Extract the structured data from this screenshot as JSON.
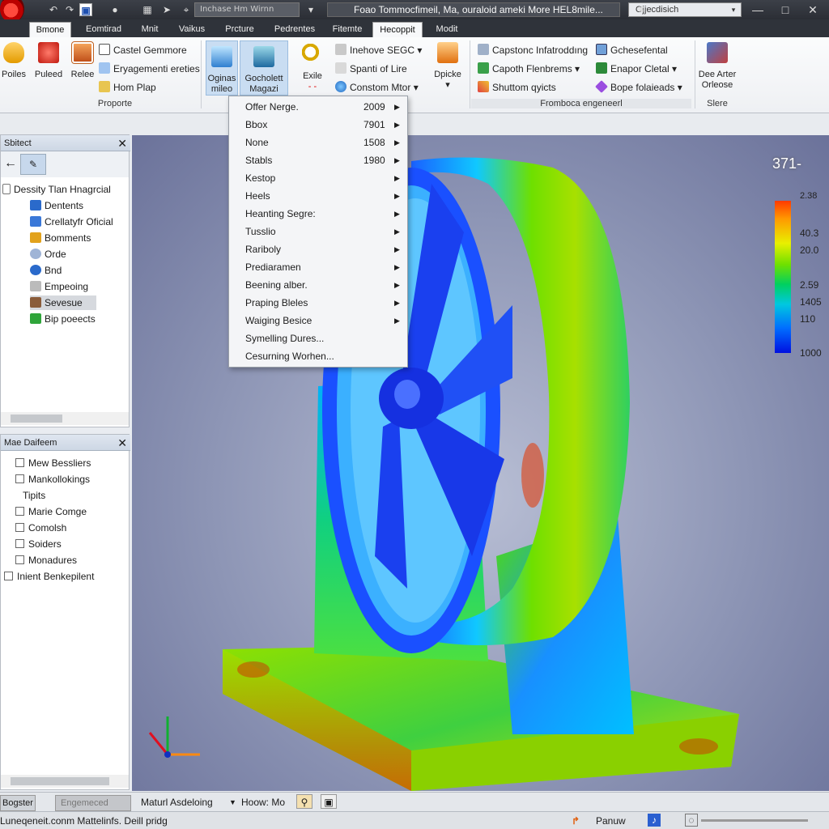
{
  "window": {
    "title": "Foao Tommocfimeil, Ma, ouraloid ameki More HEL8mile...",
    "document_tab": "Inchase Hm Wirnn",
    "search_placeholder": "Ojjecdisich"
  },
  "tabs": [
    "Bmone",
    "Eomtirad",
    "Mnit",
    "Vaikus",
    "Prcture",
    "Pedrentes",
    "Fitemte",
    "Hecoppit",
    "Modit"
  ],
  "ribbon": {
    "poiles": "Poiles",
    "pulled": "Puleed",
    "relee": "Relee",
    "small1": [
      "Castel Gemmore",
      "Eryagementi ereties",
      "Hom Plap"
    ],
    "group1": "Proporte",
    "oginas": [
      "Oginas",
      "mileo"
    ],
    "gocholett": [
      "Gocholett",
      "Magazi"
    ],
    "exile": "Exile",
    "small2": [
      "Inehove SEGC",
      "Spanti of Lire",
      "Constom Mtor"
    ],
    "dpicke": "Dpicke",
    "small3": [
      "Capstonc Infatroddıng",
      "Capoth Flenbrems",
      "Shuttom qyicts"
    ],
    "small4": [
      "Gchesefental",
      "Enapor Cletal",
      "Bope folaieads"
    ],
    "group2": "Fromboca engeneerl",
    "dee": [
      "Dee Arter",
      "Orleose"
    ],
    "group3": "Slere"
  },
  "menu": [
    {
      "label": "Offer Nerge.",
      "num": "2009"
    },
    {
      "label": "Bbox",
      "num": "7901"
    },
    {
      "label": "None",
      "num": "1508"
    },
    {
      "label": "Stabls",
      "num": "1980"
    },
    {
      "label": "Kestop",
      "num": ""
    },
    {
      "label": "Heels",
      "num": ""
    },
    {
      "label": "Heanting Segre:",
      "num": ""
    },
    {
      "label": "Tusslio",
      "num": ""
    },
    {
      "label": "Rariboly",
      "num": ""
    },
    {
      "label": "Prediaramen",
      "num": ""
    },
    {
      "label": "Beening alber.",
      "num": ""
    },
    {
      "label": "Praping Bleles",
      "num": ""
    },
    {
      "label": "Waiging Besice",
      "num": ""
    },
    {
      "label": "Symelling Dures...",
      "num": ""
    },
    {
      "label": "Cesurning Worhen...",
      "num": ""
    }
  ],
  "object_panel": {
    "title": "Sbitect",
    "items": [
      "Dessity Tlan Hnagrcial",
      "Dentents",
      "Crellatyfr Oficial",
      "Bomments",
      "Orde",
      "Bnd",
      "Empeoing",
      "Sevesue",
      "Bip poeects"
    ]
  },
  "feature_panel": {
    "title": "Mae Daifeem",
    "items": [
      "Mew Bessliers",
      "Mankollokings",
      "Tipits",
      "Marie Comge",
      "Comolsh",
      "Soiders",
      "Monadures",
      "Inient Benkepilent"
    ]
  },
  "viewport": {
    "readout": "371-",
    "legend": [
      "2.38",
      "40.3",
      "20.0",
      "2.59",
      "1405",
      "110",
      "1000"
    ],
    "colors": {
      "max": "#ff3a00",
      "mid": "#6ee000",
      "min": "#0010e0"
    }
  },
  "status": {
    "left_btn": "Bogster",
    "gray_btn": "Engemeced",
    "mode": "Maturl Asdeloing",
    "hoc": "Hoow: Mo",
    "bottom_text": "Luneqeneit.conm Mattelinfs. Deill pridg",
    "panum": "Panuw"
  }
}
